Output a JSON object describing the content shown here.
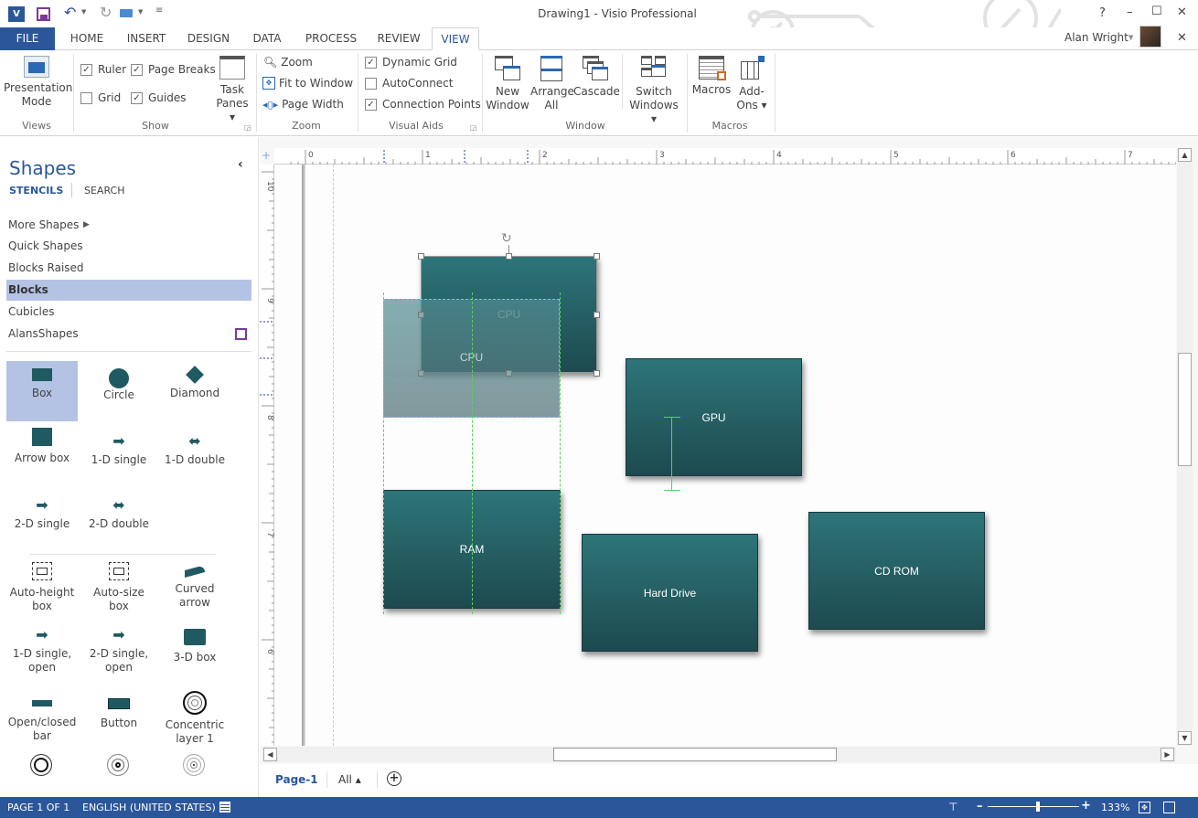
{
  "window": {
    "title": "Drawing1 - Visio Professional",
    "app_icon": "visio-icon",
    "quick_access": [
      "save-icon",
      "undo-icon",
      "redo-icon",
      "present-icon",
      "customize-icon"
    ],
    "controls": {
      "help": "?",
      "minimize": "–",
      "maximize": "☐",
      "close": "✕"
    },
    "user": "Alan Wright",
    "ribbon_close": "✕"
  },
  "tabs": [
    {
      "label": "FILE"
    },
    {
      "label": "HOME"
    },
    {
      "label": "INSERT"
    },
    {
      "label": "DESIGN"
    },
    {
      "label": "DATA"
    },
    {
      "label": "PROCESS"
    },
    {
      "label": "REVIEW"
    },
    {
      "label": "VIEW",
      "active": true
    }
  ],
  "ribbon": {
    "views": {
      "label": "Views",
      "presentation_mode": "Presentation Mode",
      "presentation_l1": "Presentation",
      "presentation_l2": "Mode"
    },
    "show": {
      "label": "Show",
      "ruler": {
        "label": "Ruler",
        "checked": true
      },
      "page_breaks": {
        "label": "Page Breaks",
        "checked": true
      },
      "grid": {
        "label": "Grid",
        "checked": false
      },
      "guides": {
        "label": "Guides",
        "checked": true
      },
      "task_panes_l1": "Task",
      "task_panes_l2": "Panes ▾"
    },
    "zoom": {
      "label": "Zoom",
      "zoom": "Zoom",
      "fit": "Fit to Window",
      "page_width": "Page Width"
    },
    "visual_aids": {
      "label": "Visual Aids",
      "dynamic_grid": {
        "label": "Dynamic Grid",
        "checked": true
      },
      "autoconnect": {
        "label": "AutoConnect",
        "checked": false
      },
      "connection_points": {
        "label": "Connection Points",
        "checked": true
      }
    },
    "window": {
      "label": "Window",
      "new_l1": "New",
      "new_l2": "Window",
      "arrange_l1": "Arrange",
      "arrange_l2": "All",
      "cascade": "Cascade",
      "switch_l1": "Switch",
      "switch_l2": "Windows ▾"
    },
    "macros": {
      "label": "Macros",
      "macros": "Macros",
      "addons_l1": "Add-",
      "addons_l2": "Ons ▾"
    }
  },
  "shapes_panel": {
    "title": "Shapes",
    "tabs": {
      "stencils": "STENCILS",
      "search": "SEARCH"
    },
    "collapse": "‹",
    "stencils": [
      {
        "label": "More Shapes",
        "has_arrow": true
      },
      {
        "label": "Quick Shapes"
      },
      {
        "label": "Blocks Raised"
      },
      {
        "label": "Blocks",
        "selected": true
      },
      {
        "label": "Cubicles"
      },
      {
        "label": "AlansShapes",
        "has_save": true
      }
    ],
    "shapes": [
      {
        "label": "Box",
        "selected": true
      },
      {
        "label": "Circle"
      },
      {
        "label": "Diamond"
      },
      {
        "label": "Arrow box"
      },
      {
        "label": "1-D single"
      },
      {
        "label": "1-D double"
      },
      {
        "label": "2-D single"
      },
      {
        "label": "2-D double"
      },
      {
        "label": "Auto-height box"
      },
      {
        "label": "Auto-size box"
      },
      {
        "label": "Curved arrow"
      },
      {
        "label": "1-D single, open"
      },
      {
        "label": "2-D single, open"
      },
      {
        "label": "3-D box"
      },
      {
        "label": "Open/closed bar"
      },
      {
        "label": "Button"
      },
      {
        "label": "Concentric layer 1"
      }
    ]
  },
  "rulers": {
    "horizontal": [
      "0",
      "1",
      "2",
      "3",
      "4",
      "5",
      "6",
      "7"
    ],
    "vertical": [
      "10",
      "9",
      "8",
      "7",
      "6"
    ]
  },
  "diagram": {
    "shapes": [
      {
        "label": "CPU",
        "state": "selected"
      },
      {
        "label": "CPU",
        "state": "drag-preview"
      },
      {
        "label": "GPU"
      },
      {
        "label": "RAM"
      },
      {
        "label": "Hard Drive"
      },
      {
        "label": "CD ROM"
      }
    ]
  },
  "page_tabs": {
    "page": "Page-1",
    "all": "All ▴",
    "add": "+"
  },
  "status": {
    "page": "PAGE 1 OF 1",
    "language": "ENGLISH (UNITED STATES)",
    "zoom_percent": "133%",
    "zoom_slider_fraction": 0.55
  }
}
